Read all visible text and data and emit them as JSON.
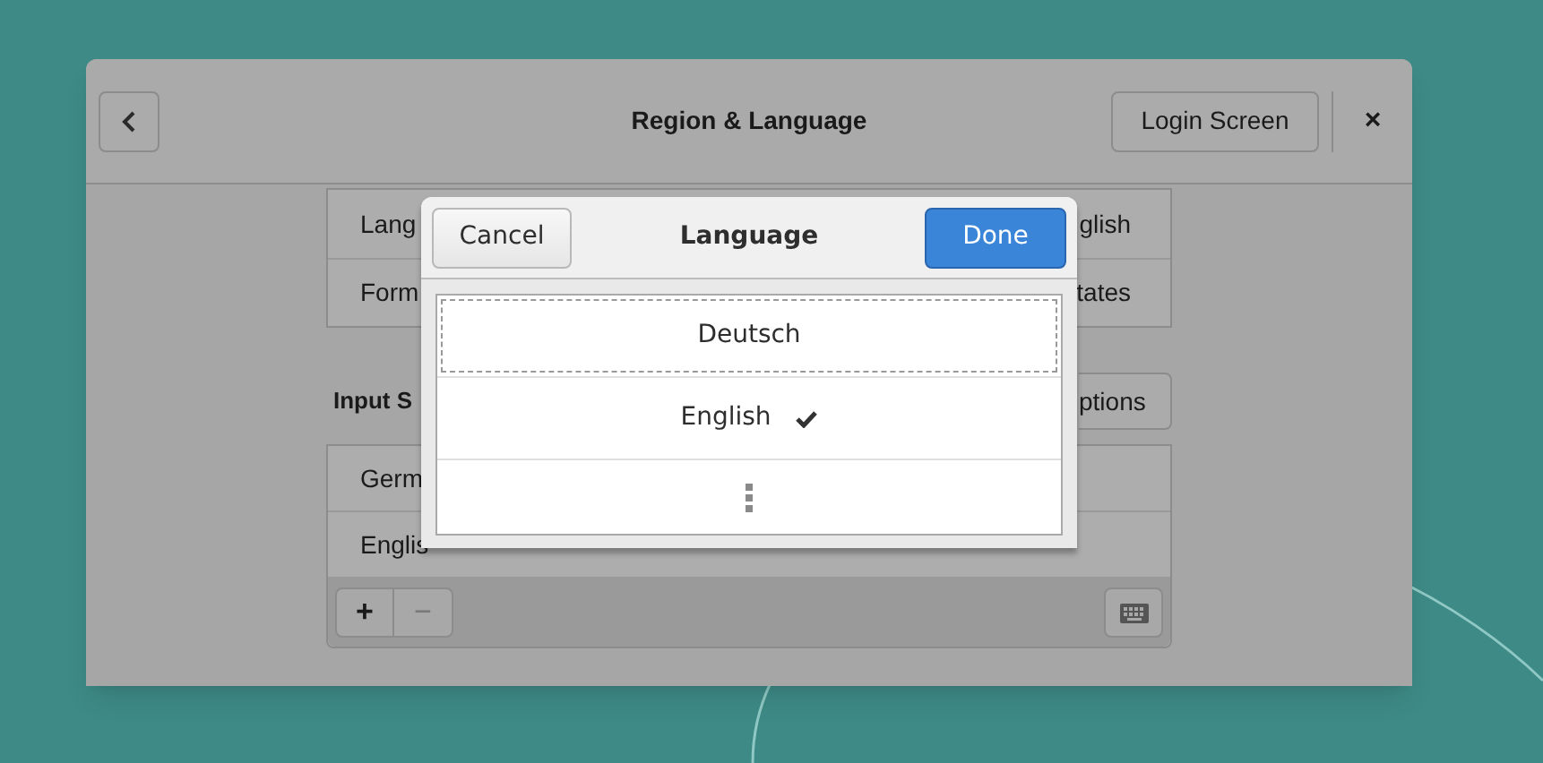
{
  "window": {
    "title": "Region & Language",
    "login_button": "Login Screen",
    "close": "×"
  },
  "settings_rows": [
    {
      "label": "Lang",
      "value": "glish"
    },
    {
      "label": "Form",
      "value": "tates"
    }
  ],
  "input_sources": {
    "heading": "Input S",
    "options_button": "ptions",
    "rows": [
      "Germ",
      "Englis"
    ],
    "add": "+",
    "remove": "−"
  },
  "dialog": {
    "title": "Language",
    "cancel": "Cancel",
    "done": "Done",
    "languages": [
      {
        "name": "Deutsch",
        "selected": false,
        "focused": true
      },
      {
        "name": "English",
        "selected": true,
        "focused": false
      }
    ]
  }
}
